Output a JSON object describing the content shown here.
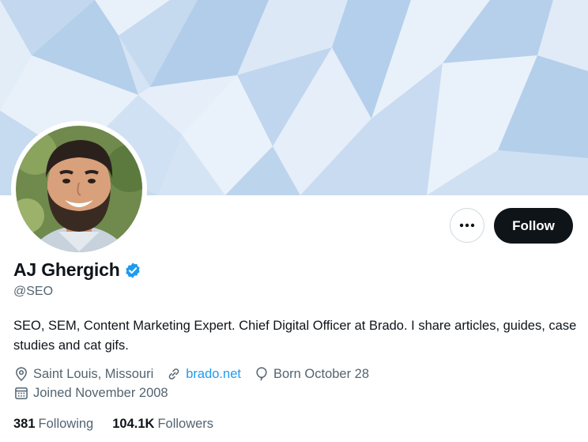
{
  "profile": {
    "name": "AJ Ghergich",
    "handle": "@SEO",
    "bio": "SEO, SEM, Content Marketing Expert. Chief Digital Officer at Brado. I share articles, guides, case studies and cat gifs.",
    "location": "Saint Louis, Missouri",
    "website": "brado.net",
    "birthday": "Born October 28",
    "joined": "Joined November 2008"
  },
  "actions": {
    "follow_label": "Follow",
    "more_icon": "more-horizontal-icon"
  },
  "stats": {
    "following_count": "381",
    "following_label": "Following",
    "followers_count": "104.1K",
    "followers_label": "Followers"
  },
  "icons": {
    "verified": "verified-badge-icon",
    "location": "location-pin-icon",
    "website": "link-icon",
    "birthday": "balloon-icon",
    "joined": "calendar-icon"
  },
  "colors": {
    "accent": "#1d9bf0",
    "follow_button": "#0f1419",
    "secondary_text": "#536471",
    "banner_light": "#e8f0fa",
    "banner_dark": "#b3cfea"
  }
}
